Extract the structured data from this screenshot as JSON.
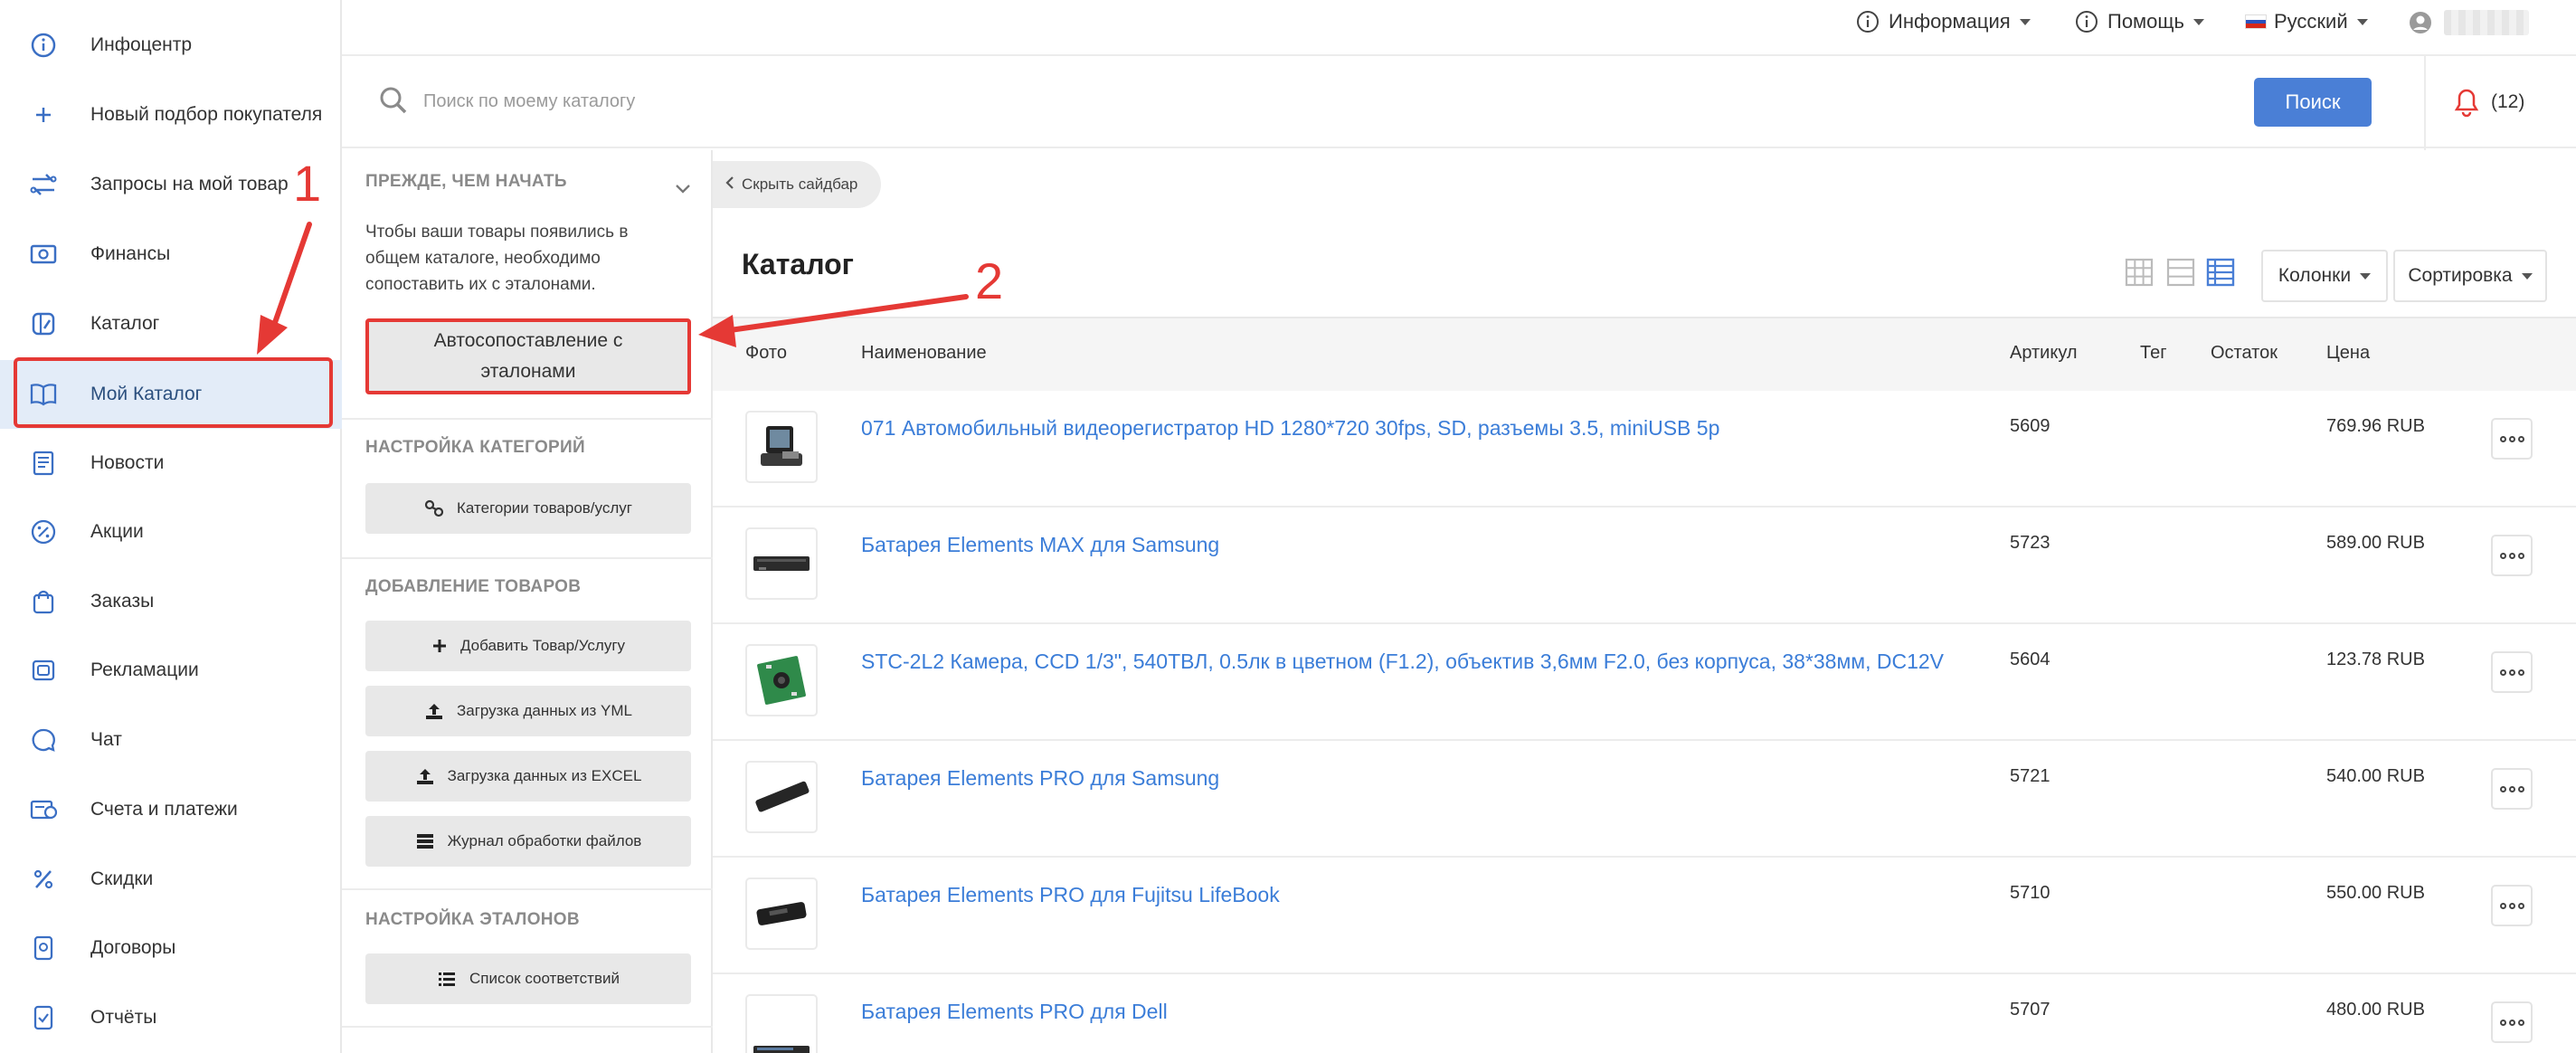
{
  "nav": {
    "items": [
      {
        "label": "Инфоцентр",
        "icon": "info-icon"
      },
      {
        "label": "Новый подбор покупателя",
        "icon": "plus-icon"
      },
      {
        "label": "Запросы на мой товар",
        "icon": "exchange-icon"
      },
      {
        "label": "Финансы",
        "icon": "money-icon"
      },
      {
        "label": "Каталог",
        "icon": "catalog-icon"
      },
      {
        "label": "Мой Каталог",
        "icon": "book-icon",
        "active": true
      },
      {
        "label": "Новости",
        "icon": "news-icon"
      },
      {
        "label": "Акции",
        "icon": "percent-badge-icon"
      },
      {
        "label": "Заказы",
        "icon": "bag-icon"
      },
      {
        "label": "Рекламации",
        "icon": "claims-icon"
      },
      {
        "label": "Чат",
        "icon": "chat-icon"
      },
      {
        "label": "Счета и платежи",
        "icon": "invoice-icon"
      },
      {
        "label": "Скидки",
        "icon": "percent-icon"
      },
      {
        "label": "Договоры",
        "icon": "contract-icon"
      },
      {
        "label": "Отчёты",
        "icon": "report-icon"
      }
    ]
  },
  "topbar": {
    "info": "Информация",
    "help": "Помощь",
    "language": "Русский"
  },
  "search": {
    "placeholder": "Поиск по моему каталогу",
    "button": "Поиск"
  },
  "notifications": {
    "count": "(12)"
  },
  "sidebar": {
    "before_start": {
      "title": "ПРЕЖДЕ, ЧЕМ НАЧАТЬ",
      "text": "Чтобы ваши товары появились в общем каталоге, необходимо сопоставить их с эталонами.",
      "button": "Автосопоставление с эталонами"
    },
    "categories": {
      "title": "НАСТРОЙКА КАТЕГОРИЙ",
      "button": "Категории товаров/услуг"
    },
    "adding": {
      "title": "ДОБАВЛЕНИЕ ТОВАРОВ",
      "buttons": [
        "Добавить Товар/Услугу",
        "Загрузка данных из YML",
        "Загрузка данных из EXCEL",
        "Журнал обработки файлов"
      ]
    },
    "standards": {
      "title": "НАСТРОЙКА ЭТАЛОНОВ",
      "button": "Список соответствий"
    }
  },
  "main": {
    "hide_sidebar": "Скрыть сайдбар",
    "title": "Каталог",
    "columns_button": "Колонки",
    "sort_button": "Сортировка",
    "headers": {
      "photo": "Фото",
      "name": "Наименование",
      "sku": "Артикул",
      "tag": "Тег",
      "stock": "Остаток",
      "price": "Цена"
    },
    "rows": [
      {
        "name": "071 Автомобильный видеорегистратор HD 1280*720 30fps, SD, разъемы 3.5, miniUSB 5p",
        "sku": "5609",
        "price": "769.96 RUB",
        "thumb": "dashcam"
      },
      {
        "name": "Батарея Elements MAX для Samsung",
        "sku": "5723",
        "price": "589.00 RUB",
        "thumb": "battery-flat"
      },
      {
        "name": "STC-2L2 Камера, CCD 1/3\", 540ТВЛ, 0.5лк в цветном (F1.2), объектив 3,6мм F2.0, без корпуса, 38*38мм, DC12V",
        "sku": "5604",
        "price": "123.78 RUB",
        "thumb": "camera-board"
      },
      {
        "name": "Батарея Elements PRO для Samsung",
        "sku": "5721",
        "price": "540.00 RUB",
        "thumb": "battery-diag"
      },
      {
        "name": "Батарея Elements PRO для Fujitsu LifeBook",
        "sku": "5710",
        "price": "550.00 RUB",
        "thumb": "battery-block"
      },
      {
        "name": "Батарея Elements PRO для Dell",
        "sku": "5707",
        "price": "480.00 RUB",
        "thumb": "battery-slim"
      }
    ]
  },
  "annotations": {
    "step1": "1",
    "step2": "2"
  },
  "colors": {
    "accent": "#4a7fd6",
    "link": "#3b7dd8",
    "annotation": "#e53935",
    "active_bg": "#e3ecf8"
  }
}
